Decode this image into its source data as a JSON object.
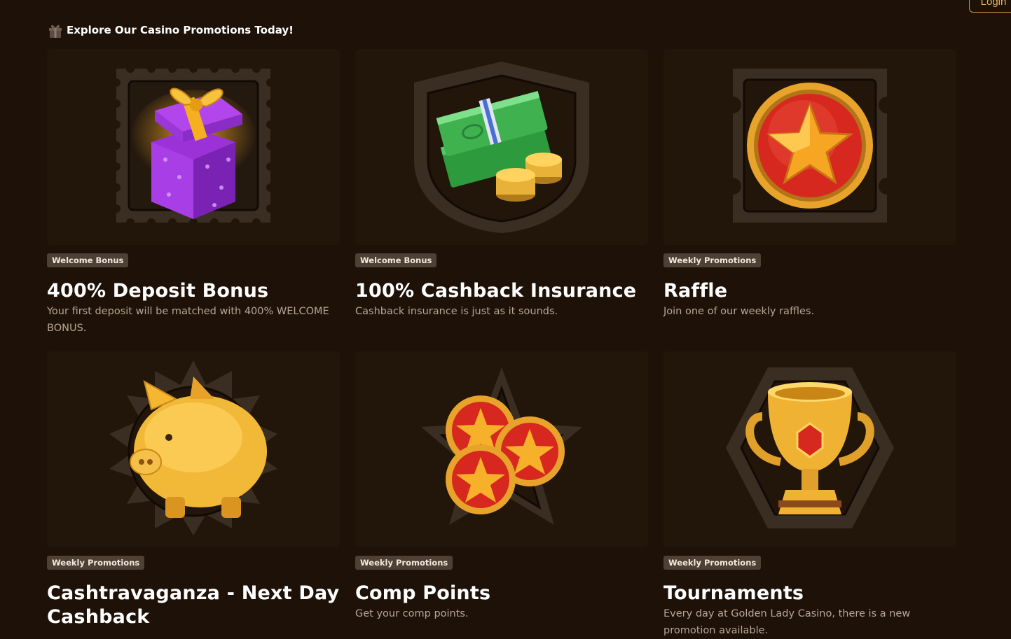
{
  "header": {
    "login_label": "Login"
  },
  "section": {
    "title": "Explore Our Casino Promotions Today!"
  },
  "promotions": [
    {
      "badge": "Welcome Bonus",
      "title": "400% Deposit Bonus",
      "description": "Your first deposit will be matched with 400% WELCOME BONUS.",
      "image_icon": "gift-box-icon"
    },
    {
      "badge": "Welcome Bonus",
      "title": "100% Cashback Insurance",
      "description": "Cashback insurance is just as it sounds.",
      "image_icon": "cash-coins-icon"
    },
    {
      "badge": "Weekly Promotions",
      "title": "Raffle",
      "description": "Join one of our weekly raffles.",
      "image_icon": "star-medal-icon"
    },
    {
      "badge": "Weekly Promotions",
      "title": "Cashtravaganza - Next Day Cashback",
      "description": "",
      "image_icon": "piggy-bank-icon"
    },
    {
      "badge": "Weekly Promotions",
      "title": "Comp Points",
      "description": "Get your comp points.",
      "image_icon": "star-coins-icon"
    },
    {
      "badge": "Weekly Promotions",
      "title": "Tournaments",
      "description": "Every day at Golden Lady Casino, there is a new promotion available.",
      "image_icon": "trophy-icon"
    }
  ],
  "colors": {
    "background": "#1e1208",
    "accent": "#c8963c",
    "badge_bg": "#4e4035",
    "description_text": "#b7a696"
  }
}
